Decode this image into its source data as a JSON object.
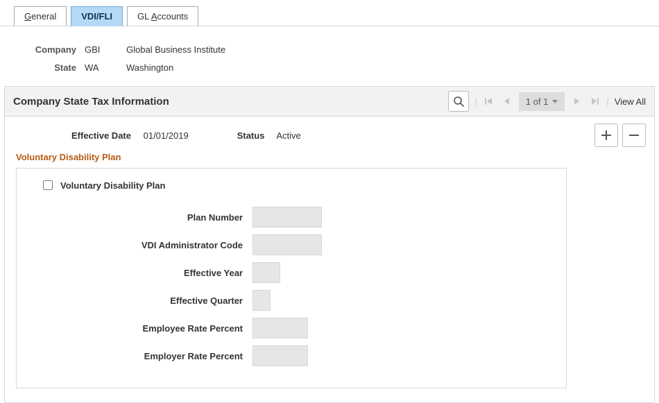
{
  "tabs": {
    "general_pre": "G",
    "general_post": "eneral",
    "vdi": "VDI/FLI",
    "gl_pre": "GL ",
    "gl_ul": "A",
    "gl_post": "ccounts"
  },
  "header": {
    "company_label": "Company",
    "company_code": "GBI",
    "company_name": "Global Business Institute",
    "state_label": "State",
    "state_code": "WA",
    "state_name": "Washington"
  },
  "section": {
    "title": "Company State Tax Information",
    "page_indicator": "1 of 1",
    "view_all": "View All"
  },
  "scroll": {
    "effective_date_label": "Effective Date",
    "effective_date": "01/01/2019",
    "status_label": "Status",
    "status": "Active"
  },
  "group": {
    "heading": "Voluntary Disability Plan",
    "checkbox_label": "Voluntary Disability Plan",
    "checked": false,
    "plan_number_label": "Plan Number",
    "plan_number": "",
    "vdi_admin_label": "VDI Administrator Code",
    "vdi_admin": "",
    "eff_year_label": "Effective Year",
    "eff_year": "",
    "eff_quarter_label": "Effective Quarter",
    "eff_quarter": "",
    "employee_rate_label": "Employee Rate Percent",
    "employee_rate": "",
    "employer_rate_label": "Employer Rate Percent",
    "employer_rate": ""
  }
}
